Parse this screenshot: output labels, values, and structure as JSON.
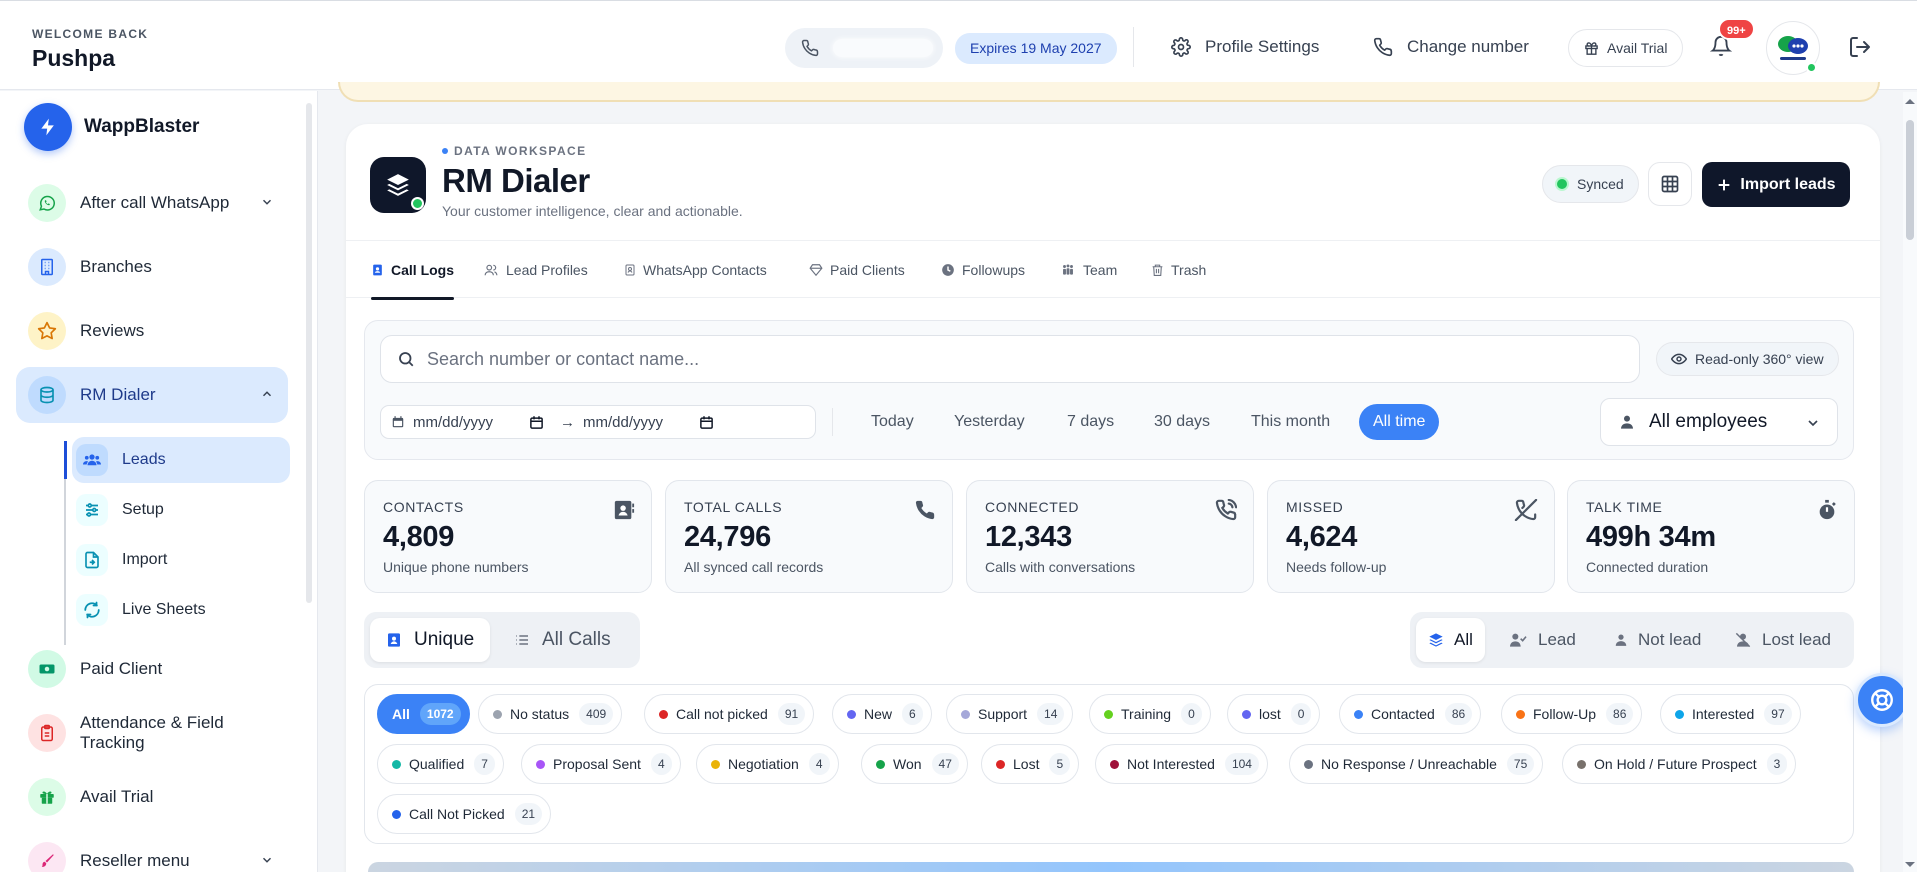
{
  "header": {
    "welcome": "WELCOME BACK",
    "user_name": "Pushpa",
    "expires": "Expires 19 May 2027",
    "profile_settings": "Profile Settings",
    "change_number": "Change number",
    "avail_trial": "Avail Trial",
    "notif_badge": "99+"
  },
  "sidebar": {
    "brand": "WappBlaster",
    "items": [
      {
        "label": "After call WhatsApp"
      },
      {
        "label": "Branches"
      },
      {
        "label": "Reviews"
      },
      {
        "label": "RM Dialer"
      },
      {
        "label": "Paid Client"
      },
      {
        "label": "Attendance & Field Tracking"
      },
      {
        "label": "Avail Trial"
      },
      {
        "label": "Reseller menu"
      }
    ],
    "sub_items": [
      {
        "label": "Leads"
      },
      {
        "label": "Setup"
      },
      {
        "label": "Import"
      },
      {
        "label": "Live Sheets"
      }
    ]
  },
  "page": {
    "eyebrow": "DATA WORKSPACE",
    "title": "RM Dialer",
    "subtitle": "Your customer intelligence, clear and actionable.",
    "synced": "Synced",
    "import_label": "Import leads"
  },
  "tabs": [
    {
      "label": "Call Logs"
    },
    {
      "label": "Lead Profiles"
    },
    {
      "label": "WhatsApp Contacts"
    },
    {
      "label": "Paid Clients"
    },
    {
      "label": "Followups"
    },
    {
      "label": "Team"
    },
    {
      "label": "Trash"
    }
  ],
  "filters": {
    "search_placeholder": "Search number or contact name...",
    "readonly": "Read-only 360° view",
    "date_from": "mm/dd/yyyy",
    "date_arrow": "→",
    "date_to": "mm/dd/yyyy",
    "quick": [
      "Today",
      "Yesterday",
      "7 days",
      "30 days",
      "This month",
      "All time"
    ],
    "quick_active": "All time",
    "employee": "All employees"
  },
  "stats": [
    {
      "label": "CONTACTS",
      "value": "4,809",
      "sub": "Unique phone numbers",
      "icon": "contact-card-icon"
    },
    {
      "label": "TOTAL CALLS",
      "value": "24,796",
      "sub": "All synced call records",
      "icon": "phone-icon"
    },
    {
      "label": "CONNECTED",
      "value": "12,343",
      "sub": "Calls with conversations",
      "icon": "phone-connected-icon"
    },
    {
      "label": "MISSED",
      "value": "4,624",
      "sub": "Needs follow-up",
      "icon": "phone-missed-icon"
    },
    {
      "label": "TALK TIME",
      "value": "499h 34m",
      "sub": "Connected duration",
      "icon": "stopwatch-icon"
    }
  ],
  "view_toggle": {
    "unique": "Unique",
    "all_calls": "All Calls"
  },
  "lead_filter": {
    "all": "All",
    "lead": "Lead",
    "not_lead": "Not lead",
    "lost_lead": "Lost lead"
  },
  "statuses": [
    {
      "label": "All",
      "count": "1072",
      "color": "#ffffff"
    },
    {
      "label": "No status",
      "count": "409",
      "color": "#9ca3af"
    },
    {
      "label": "Call not picked",
      "count": "91",
      "color": "#dc2626"
    },
    {
      "label": "New",
      "count": "6",
      "color": "#6366f1"
    },
    {
      "label": "Support",
      "count": "14",
      "color": "#a5a8d9"
    },
    {
      "label": "Training",
      "count": "0",
      "color": "#65d11f"
    },
    {
      "label": "lost",
      "count": "0",
      "color": "#6366f1"
    },
    {
      "label": "Contacted",
      "count": "86",
      "color": "#3b82f6"
    },
    {
      "label": "Follow-Up",
      "count": "86",
      "color": "#f97316"
    },
    {
      "label": "Interested",
      "count": "97",
      "color": "#0ea5e9"
    },
    {
      "label": "Qualified",
      "count": "7",
      "color": "#14b8a6"
    },
    {
      "label": "Proposal Sent",
      "count": "4",
      "color": "#a855f7"
    },
    {
      "label": "Negotiation",
      "count": "4",
      "color": "#eab308"
    },
    {
      "label": "Won",
      "count": "47",
      "color": "#16a34a"
    },
    {
      "label": "Lost",
      "count": "5",
      "color": "#dc2626"
    },
    {
      "label": "Not Interested",
      "count": "104",
      "color": "#9f1239"
    },
    {
      "label": "No Response / Unreachable",
      "count": "75",
      "color": "#6b7280"
    },
    {
      "label": "On Hold / Future Prospect",
      "count": "3",
      "color": "#78716c"
    },
    {
      "label": "Call Not Picked",
      "count": "21",
      "color": "#2563eb"
    }
  ]
}
